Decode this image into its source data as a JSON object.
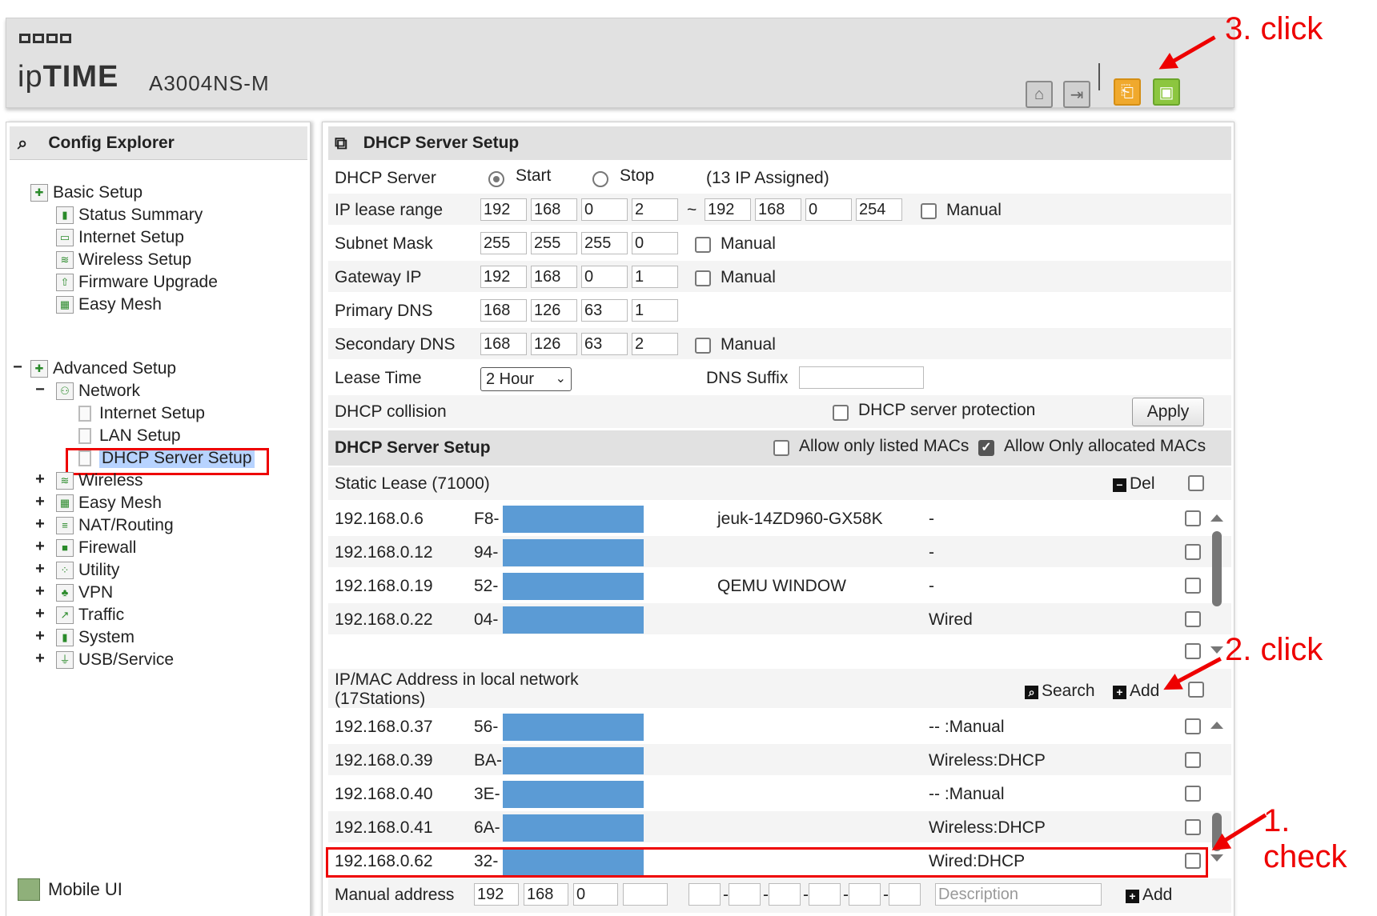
{
  "header": {
    "brand_prefix": "ip",
    "brand_main": "TIME",
    "model": "A3004NS-M",
    "icons": [
      "home-icon",
      "logout-icon",
      "restore-icon",
      "save-icon"
    ]
  },
  "sidebar": {
    "title": "Config Explorer",
    "basic": {
      "label": "Basic Setup",
      "items": [
        "Status Summary",
        "Internet Setup",
        "Wireless Setup",
        "Firmware Upgrade",
        "Easy Mesh"
      ]
    },
    "advanced": {
      "toggle": "−",
      "label": "Advanced Setup",
      "network": {
        "toggle": "−",
        "label": "Network",
        "items": [
          "Internet Setup",
          "LAN Setup",
          "DHCP Server Setup"
        ]
      },
      "groups": [
        "Wireless",
        "Easy Mesh",
        "NAT/Routing",
        "Firewall",
        "Utility",
        "VPN",
        "Traffic",
        "System",
        "USB/Service"
      ],
      "group_toggle": "+"
    },
    "mobile": "Mobile UI"
  },
  "main": {
    "title": "DHCP Server Setup",
    "dhcp_server": {
      "label": "DHCP Server",
      "start": "Start",
      "stop": "Stop",
      "assigned": "(13 IP Assigned)"
    },
    "ip_lease": {
      "label": "IP lease range",
      "from": [
        "192",
        "168",
        "0",
        "2"
      ],
      "tilde": "~",
      "to": [
        "192",
        "168",
        "0",
        "254"
      ],
      "manual": "Manual"
    },
    "subnet": {
      "label": "Subnet Mask",
      "values": [
        "255",
        "255",
        "255",
        "0"
      ],
      "manual": "Manual"
    },
    "gateway": {
      "label": "Gateway IP",
      "values": [
        "192",
        "168",
        "0",
        "1"
      ],
      "manual": "Manual"
    },
    "primary_dns": {
      "label": "Primary DNS",
      "values": [
        "168",
        "126",
        "63",
        "1"
      ]
    },
    "secondary_dns": {
      "label": "Secondary DNS",
      "values": [
        "168",
        "126",
        "63",
        "2"
      ],
      "manual": "Manual"
    },
    "lease_time": {
      "label": "Lease Time",
      "value": "2 Hour",
      "arrow": "⌄",
      "dns_suffix": "DNS Suffix"
    },
    "collision": {
      "label": "DHCP collision",
      "protection": "DHCP server protection",
      "apply": "Apply"
    }
  },
  "setup2": {
    "title": "DHCP Server Setup",
    "allow_listed": "Allow only listed MACs",
    "allow_allocated": "Allow Only allocated MACs",
    "allow_allocated_checked": true
  },
  "static_lease": {
    "title": "Static Lease (71000)",
    "del": "Del",
    "rows": [
      {
        "ip": "192.168.0.6",
        "mac": "F8-",
        "name": "jeuk-14ZD960-GX58K",
        "desc": "-"
      },
      {
        "ip": "192.168.0.12",
        "mac": "94-",
        "name": "",
        "desc": "-"
      },
      {
        "ip": "192.168.0.19",
        "mac": "52-",
        "name": "QEMU WINDOW",
        "desc": "-"
      },
      {
        "ip": "192.168.0.22",
        "mac": "04-",
        "name": "",
        "desc": "Wired"
      }
    ]
  },
  "local_network": {
    "title_line1": "IP/MAC Address in local network",
    "title_line2": "(17Stations)",
    "search": "Search",
    "add": "Add",
    "rows": [
      {
        "ip": "192.168.0.37",
        "mac": "56-",
        "type": "-- :Manual"
      },
      {
        "ip": "192.168.0.39",
        "mac": "BA-",
        "type": "Wireless:DHCP"
      },
      {
        "ip": "192.168.0.40",
        "mac": "3E-",
        "type": "-- :Manual"
      },
      {
        "ip": "192.168.0.41",
        "mac": "6A-",
        "type": "Wireless:DHCP"
      },
      {
        "ip": "192.168.0.62",
        "mac": "32-",
        "type": "Wired:DHCP"
      }
    ]
  },
  "manual_address": {
    "label": "Manual address",
    "ip": [
      "192",
      "168",
      "0",
      ""
    ],
    "mac_sep": "-",
    "description_placeholder": "Description",
    "add": "Add"
  },
  "annotations": {
    "step1": "1. check",
    "step2": "2. click",
    "step3": "3. click",
    "color": "#e00000"
  },
  "colors": {
    "mac_mask": "#5b9bd5",
    "header_bg": "#e1e1e1",
    "selection": "#b7d3ff"
  }
}
